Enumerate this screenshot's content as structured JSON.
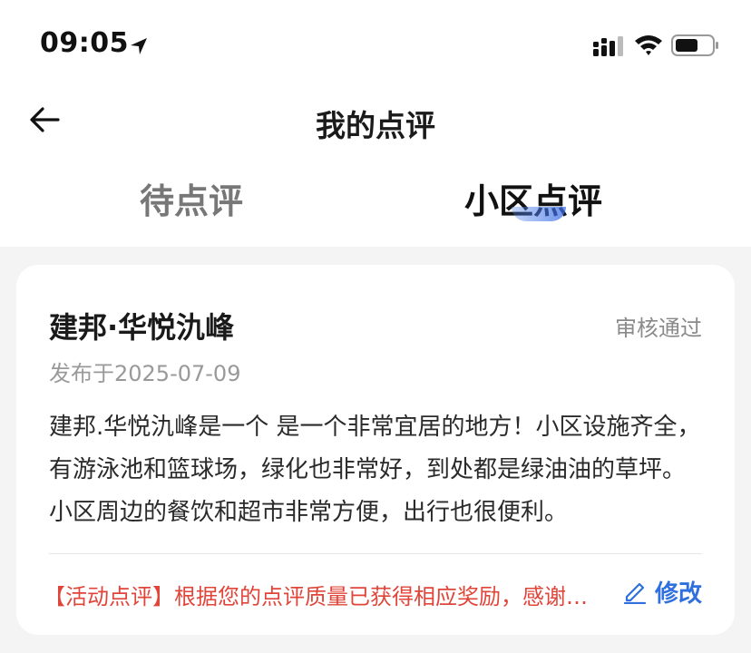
{
  "status_bar": {
    "time": "09:05"
  },
  "nav": {
    "title": "我的点评"
  },
  "tabs": [
    {
      "label": "待点评",
      "active": false
    },
    {
      "label": "小区点评",
      "active": true
    }
  ],
  "review": {
    "title": "建邦·华悦氿峰",
    "status": "审核通过",
    "date": "发布于2025-07-09",
    "body": "建邦.华悦氿峰是一个 是一个非常宜居的地方！小区设施齐全，有游泳池和篮球场，绿化也非常好，到处都是绿油油的草坪。小区周边的餐饮和超市非常方便，出行也很便利。",
    "reward_note": "【活动点评】根据您的点评质量已获得相应奖励，感谢您的参与",
    "edit_label": "修改"
  },
  "colors": {
    "accent": "#2f6fde",
    "reward": "#e0453a",
    "background": "#f4f4f4"
  }
}
